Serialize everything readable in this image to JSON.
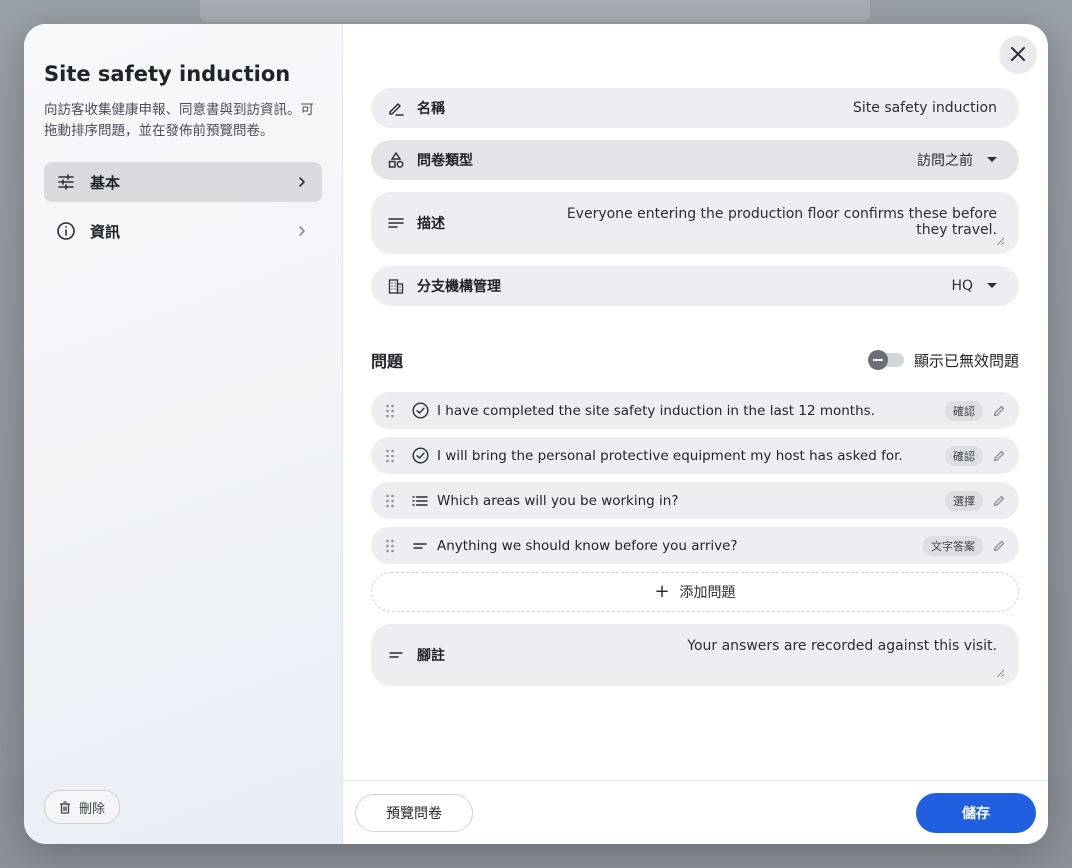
{
  "sidebar": {
    "title": "Site safety induction",
    "description": "向訪客收集健康申報、同意書與到訪資訊。可拖動排序問題，並在發佈前預覽問卷。",
    "items": [
      {
        "label": "基本",
        "icon": "sliders-icon",
        "active": true
      },
      {
        "label": "資訊",
        "icon": "info-icon",
        "active": false
      }
    ],
    "delete_label": "刪除"
  },
  "form": {
    "name": {
      "label": "名稱",
      "value": "Site safety induction"
    },
    "type": {
      "label": "問卷類型",
      "value": "訪問之前"
    },
    "description": {
      "label": "描述",
      "value": "Everyone entering the production floor confirms these before they travel."
    },
    "branch": {
      "label": "分支機構管理",
      "value": "HQ"
    }
  },
  "questions": {
    "title": "問題",
    "toggle_label": "顯示已無效問題",
    "toggle_on": false,
    "items": [
      {
        "text": "I have completed the site safety induction in the last 12 months.",
        "type": "確認",
        "icon": "check-circle-icon"
      },
      {
        "text": "I will bring the personal protective equipment my host has asked for.",
        "type": "確認",
        "icon": "check-circle-icon"
      },
      {
        "text": "Which areas will you be working in?",
        "type": "選擇",
        "icon": "list-icon"
      },
      {
        "text": "Anything we should know before you arrive?",
        "type": "文字答案",
        "icon": "short-text-icon"
      }
    ],
    "add_label": "添加問題"
  },
  "footnote": {
    "label": "腳註",
    "value": "Your answers are recorded against this visit."
  },
  "footer": {
    "preview_label": "預覽問卷",
    "save_label": "儲存"
  },
  "colors": {
    "accent": "#1f5fe0",
    "field_bg": "#eceef1",
    "sidebar_active": "#d9dbdf"
  }
}
